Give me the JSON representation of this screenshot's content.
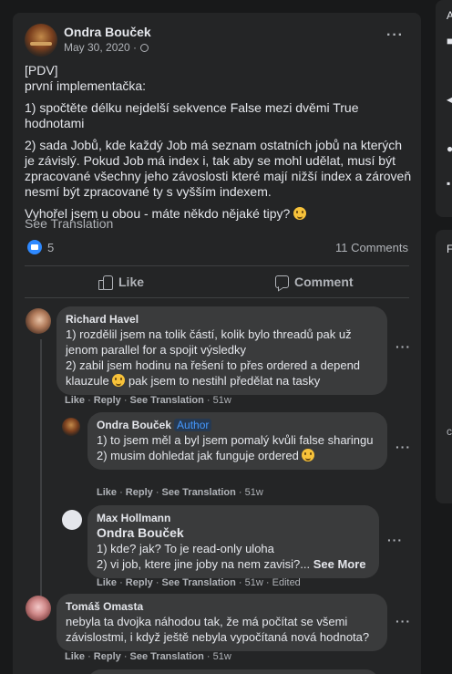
{
  "post": {
    "author": "Ondra Bouček",
    "date": "May 30, 2020 ·",
    "paragraphs": [
      {
        "l1": "[PDV]",
        "l2": "první implementačka:"
      },
      {
        "l1": "1) spočtěte délku nejdelší sekvence False mezi dvěmi True hodnotami"
      },
      {
        "l1": "2) sada Jobů, kde každý Job má seznam ostatních jobů na kterých je závislý. Pokud Job má index i, tak aby se mohl udělat, musí být zpracované všechny jeho závoslosti které mají nižší index a zároveň nesmí být zpracované ty s vyšším indexem."
      },
      {
        "l1": "Vyhořel jsem u obou - máte někdo nějaké tipy?"
      }
    ],
    "see_translation": "See Translation",
    "like_count": "5",
    "comments_count": "11 Comments",
    "like_label": "Like",
    "comment_label": "Comment"
  },
  "comments": [
    {
      "name": "Richard Havel",
      "text": "1) rozdělil jsem na tolik částí, kolik bylo threadů pak už jenom parallel for a spojit výsledky\n2) zabil jsem hodinu na řešení to přes ordered a depend klauzule",
      "text_after": " pak jsem to nestihl předělat na tasky",
      "meta": {
        "like": "Like",
        "reply": "Reply",
        "see": "See Translation",
        "time": "51w"
      }
    },
    {
      "name": "Ondra Bouček",
      "badge": "Author",
      "text": "1) to jsem měl a byl jsem pomalý kvůli false sharingu\n2) musim dohledat jak funguje ordered",
      "meta": {
        "like": "Like",
        "reply": "Reply",
        "see": "See Translation",
        "time": "51w"
      }
    },
    {
      "name": "Max Hollmann",
      "mention": "Ondra Bouček",
      "text": "1) kde? jak? To je read-only uloha\n2) vi job, ktere jine joby na nem zavisi?...",
      "see_more": "See More",
      "meta": {
        "like": "Like",
        "reply": "Reply",
        "see": "See Translation",
        "time": "51w",
        "edited": "Edited"
      }
    },
    {
      "name": "Tomáš Omasta",
      "text": "nebyla ta dvojka náhodou tak, že má počítat se všemi závislostmi, i když ještě nebyla vypočítaná nová hodnota?",
      "meta": {
        "like": "Like",
        "reply": "Reply",
        "see": "See Translation",
        "time": "51w"
      }
    }
  ],
  "colors": {
    "background": "#18191a",
    "card": "#242526",
    "bubble": "#3a3b3c",
    "accent": "#2e89ff",
    "muted": "#b0b3b8"
  }
}
